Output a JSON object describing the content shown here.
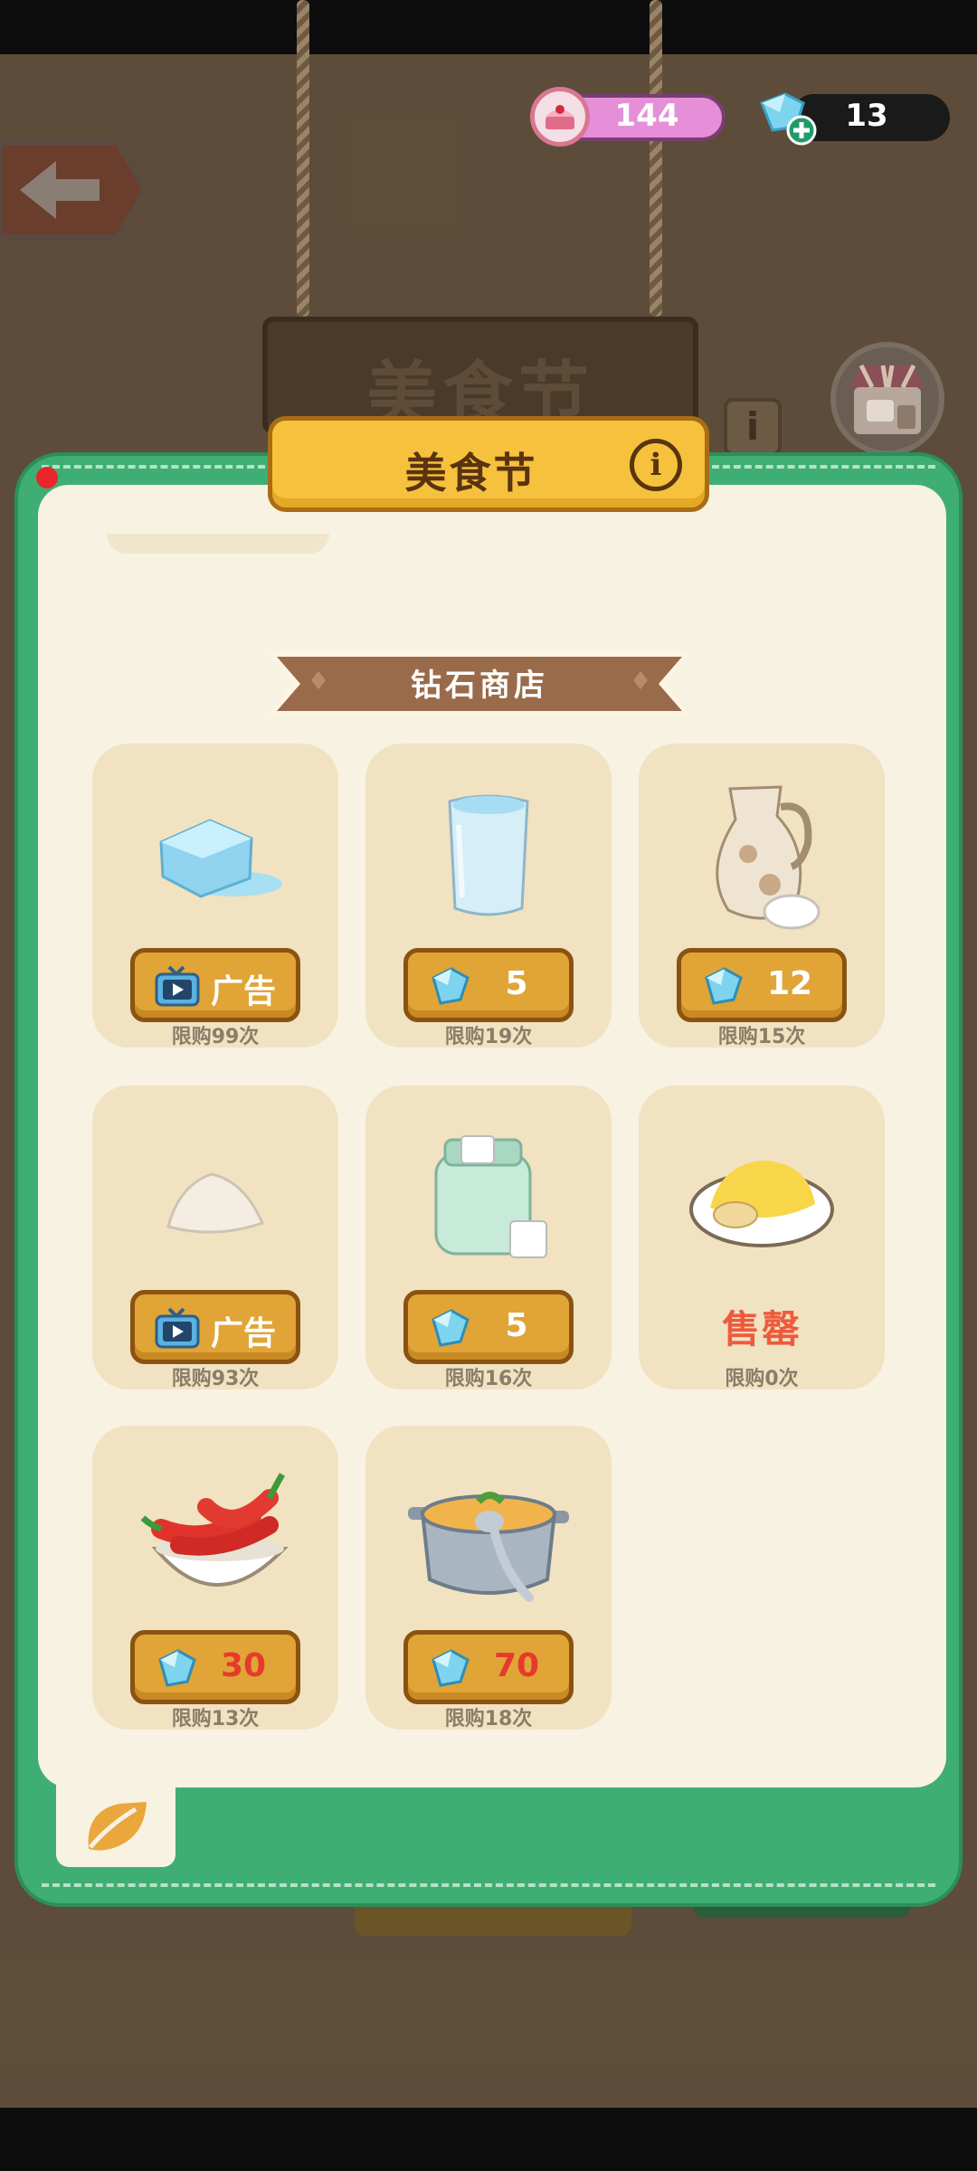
{
  "background": {
    "sign_text": "美食节",
    "info_glyph": "i"
  },
  "currency": {
    "cake_value": "144",
    "gem_value": "13"
  },
  "modal": {
    "title": "美食节",
    "info_glyph": "i",
    "section_title": "钻石商店"
  },
  "items": [
    {
      "name": "ice",
      "price_icon": "tv-ad-icon",
      "price_label": "广告",
      "limit": "限购99次"
    },
    {
      "name": "water",
      "price_icon": "diamond-icon",
      "price_label": "5",
      "limit": "限购19次"
    },
    {
      "name": "milk",
      "price_icon": "diamond-icon",
      "price_label": "12",
      "limit": "限购15次"
    },
    {
      "name": "flour",
      "price_icon": "tv-ad-icon",
      "price_label": "广告",
      "limit": "限购93次"
    },
    {
      "name": "sugar",
      "price_icon": "diamond-icon",
      "price_label": "5",
      "limit": "限购16次"
    },
    {
      "name": "scrambled-egg",
      "soldout_label": "售罄",
      "limit": "限购0次"
    },
    {
      "name": "chili",
      "price_icon": "diamond-icon",
      "price_label": "30",
      "limit": "限购13次"
    },
    {
      "name": "soup-pot",
      "price_icon": "diamond-icon",
      "price_label": "70",
      "limit": "限购18次"
    }
  ],
  "colors": {
    "modal_green": "#3fae73",
    "panel_cream": "#f8f2e2",
    "card_bg": "#f1e2c2",
    "price_button": "#e0a437",
    "soldout_red": "#ec5b3c",
    "expensive_price_red": "#e53a2d"
  }
}
